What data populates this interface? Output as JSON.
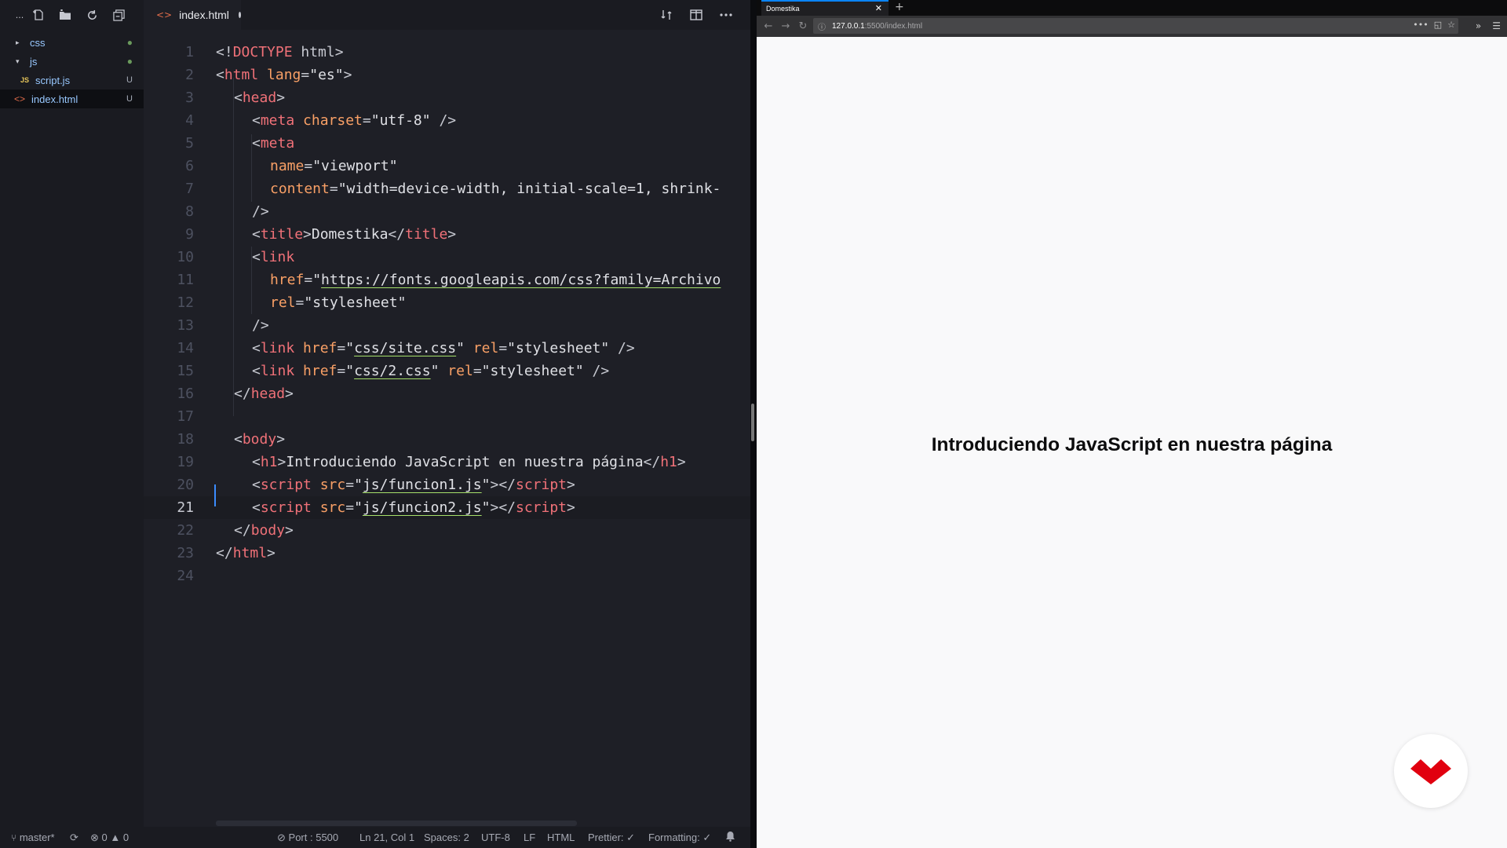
{
  "explorer": {
    "toolbar": [
      "more-icon",
      "new-file-icon",
      "new-folder-icon",
      "refresh-icon",
      "collapse-icon"
    ],
    "more_glyph": "...",
    "items": [
      {
        "label": "css",
        "status": "●",
        "indent": 0,
        "twisty": "▸"
      },
      {
        "label": "js",
        "status": "●",
        "indent": 0,
        "twisty": "▾"
      },
      {
        "label": "script.js",
        "status": "U",
        "badge": "JS"
      },
      {
        "label": "index.html",
        "status": "U",
        "glyph": "<>"
      }
    ]
  },
  "tab": {
    "label": "index.html",
    "modified": true
  },
  "code": {
    "lines": [
      {
        "n": "1"
      },
      {
        "n": "2"
      },
      {
        "n": "3"
      },
      {
        "n": "4"
      },
      {
        "n": "5"
      },
      {
        "n": "6"
      },
      {
        "n": "7"
      },
      {
        "n": "8"
      },
      {
        "n": "9"
      },
      {
        "n": "10"
      },
      {
        "n": "11"
      },
      {
        "n": "12"
      },
      {
        "n": "13"
      },
      {
        "n": "14"
      },
      {
        "n": "15"
      },
      {
        "n": "16"
      },
      {
        "n": "17"
      },
      {
        "n": "18"
      },
      {
        "n": "19"
      },
      {
        "n": "20"
      },
      {
        "n": "21"
      },
      {
        "n": "22"
      },
      {
        "n": "23"
      },
      {
        "n": "24"
      }
    ],
    "t": {
      "l1a": "<!",
      "l1b": "DOCTYPE",
      "l1c": " html",
      "l1d": ">",
      "l2a": "<",
      "l2b": "html",
      "l2c": " lang",
      "l2d": "=",
      "l2e": "\"es\"",
      "l2f": ">",
      "l3a": "<",
      "l3b": "head",
      "l3c": ">",
      "l4a": "<",
      "l4b": "meta",
      "l4c": " charset",
      "l4d": "=",
      "l4e": "\"utf-8\"",
      "l4f": " />",
      "l5a": "<",
      "l5b": "meta",
      "l6a": "name",
      "l6b": "=",
      "l6c": "\"viewport\"",
      "l7a": "content",
      "l7b": "=",
      "l7c": "\"width=device-width, initial-scale=1, shrink-",
      "l8a": "/>",
      "l9a": "<",
      "l9b": "title",
      "l9c": ">",
      "l9d": "Domestika",
      "l9e": "</",
      "l9f": "title",
      "l9g": ">",
      "l10a": "<",
      "l10b": "link",
      "l11a": "href",
      "l11b": "=",
      "l11c": "\"",
      "l11d": "https://fonts.googleapis.com/css?family=Archivo",
      "l12a": "rel",
      "l12b": "=",
      "l12c": "\"stylesheet\"",
      "l13a": "/>",
      "l14a": "<",
      "l14b": "link",
      "l14c": " href",
      "l14d": "=",
      "l14e": "\"",
      "l14f": "css/site.css",
      "l14g": "\"",
      "l14h": " rel",
      "l14i": "=",
      "l14j": "\"stylesheet\"",
      "l14k": " />",
      "l15a": "<",
      "l15b": "link",
      "l15c": " href",
      "l15d": "=",
      "l15e": "\"",
      "l15f": "css/2.css",
      "l15g": "\"",
      "l15h": " rel",
      "l15i": "=",
      "l15j": "\"stylesheet\"",
      "l15k": " />",
      "l16a": "</",
      "l16b": "head",
      "l16c": ">",
      "l18a": "<",
      "l18b": "body",
      "l18c": ">",
      "l19a": "<",
      "l19b": "h1",
      "l19c": ">",
      "l19d": "Introduciendo JavaScript en nuestra página",
      "l19e": "</",
      "l19f": "h1",
      "l19g": ">",
      "l20a": "<",
      "l20b": "script",
      "l20c": " src",
      "l20d": "=",
      "l20e": "\"",
      "l20f": "js/funcion1.js",
      "l20g": "\"",
      "l20h": "></",
      "l20i": "script",
      "l20j": ">",
      "l21a": "<",
      "l21b": "script",
      "l21c": " src",
      "l21d": "=",
      "l21e": "\"",
      "l21f": "js/funcion2.js",
      "l21g": "\"",
      "l21h": "></",
      "l21i": "script",
      "l21j": ">",
      "l22a": "</",
      "l22b": "body",
      "l22c": ">",
      "l23a": "</",
      "l23b": "html",
      "l23c": ">"
    }
  },
  "status": {
    "branch": "master*",
    "errors": "0",
    "warnings": "0",
    "port": "Port : 5500",
    "position": "Ln 21, Col 1",
    "spaces": "Spaces: 2",
    "encoding": "UTF-8",
    "eol": "LF",
    "language": "HTML",
    "prettier": "Prettier: ✓",
    "formatting": "Formatting: ✓"
  },
  "browser": {
    "tab_title": "Domestika",
    "url_host": "127.0.0.1",
    "url_path": ":5500/index.html",
    "page_heading": "Introduciendo JavaScript en nuestra página",
    "accent": "#0a84ff",
    "logo_color": "#e1000f"
  }
}
